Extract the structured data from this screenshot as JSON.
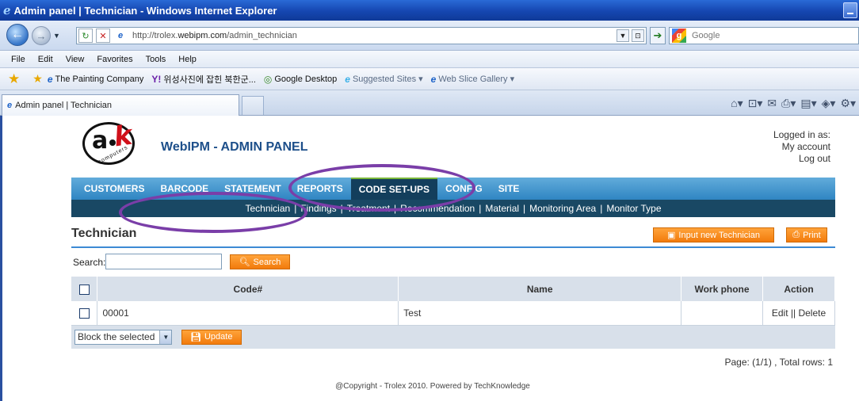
{
  "browser": {
    "window_title": "Admin panel | Technician - Windows Internet Explorer",
    "url_prefix": "http://trolex.",
    "url_domain": "webipm.com",
    "url_path": "/admin_technician",
    "search_placeholder": "Google",
    "menu": [
      "File",
      "Edit",
      "View",
      "Favorites",
      "Tools",
      "Help"
    ],
    "favorites": [
      {
        "label": "The Painting Company",
        "icon": "ie-page-icon"
      },
      {
        "label": "위성사진에 잡힌 북한군...",
        "icon": "yahoo-icon"
      },
      {
        "label": "Google Desktop",
        "icon": "google-desktop-icon"
      },
      {
        "label": "Suggested Sites ▾",
        "icon": "ie-icon"
      },
      {
        "label": "Web Slice Gallery ▾",
        "icon": "ie-page-icon"
      }
    ],
    "tab_title": "Admin panel | Technician"
  },
  "header": {
    "logo_text_a": "a",
    "logo_text_k": "k",
    "logo_sub": "computers",
    "site_title": "WebIPM - ADMIN PANEL",
    "login": {
      "status": "Logged in as:",
      "account": "My account",
      "logout": "Log out"
    }
  },
  "nav": {
    "main": [
      "CUSTOMERS",
      "BARCODE",
      "STATEMENT",
      "REPORTS",
      "CODE SET-UPS",
      "CONFIG",
      "SITE"
    ],
    "active_index": 4,
    "sub": [
      "Technician",
      "Findings",
      "Treatment",
      "Recommendation",
      "Material",
      "Monitoring Area",
      "Monitor Type"
    ],
    "sub_sep": "|"
  },
  "page": {
    "title": "Technician",
    "input_new_label": "Input new Technician",
    "print_label": "Print",
    "search_label": "Search:",
    "search_value": "",
    "search_button": "Search"
  },
  "table": {
    "columns": [
      "Code#",
      "Name",
      "Work phone",
      "Action"
    ],
    "rows": [
      {
        "code": "00001",
        "name": "Test",
        "phone": "",
        "edit": "Edit",
        "sep": "||",
        "delete": "Delete"
      }
    ],
    "bulk_action": "Block the selected",
    "update_button": "Update"
  },
  "pager": "Page: (1/1) , Total rows: 1",
  "footer": "@Copyright - Trolex 2010. Powered by TechKnowledge",
  "colors": {
    "nav_blue": "#2f85c2",
    "nav_active": "#133e5c",
    "subnav": "#194864",
    "accent_orange": "#f27b0c",
    "annotation": "#7a3ea8"
  }
}
